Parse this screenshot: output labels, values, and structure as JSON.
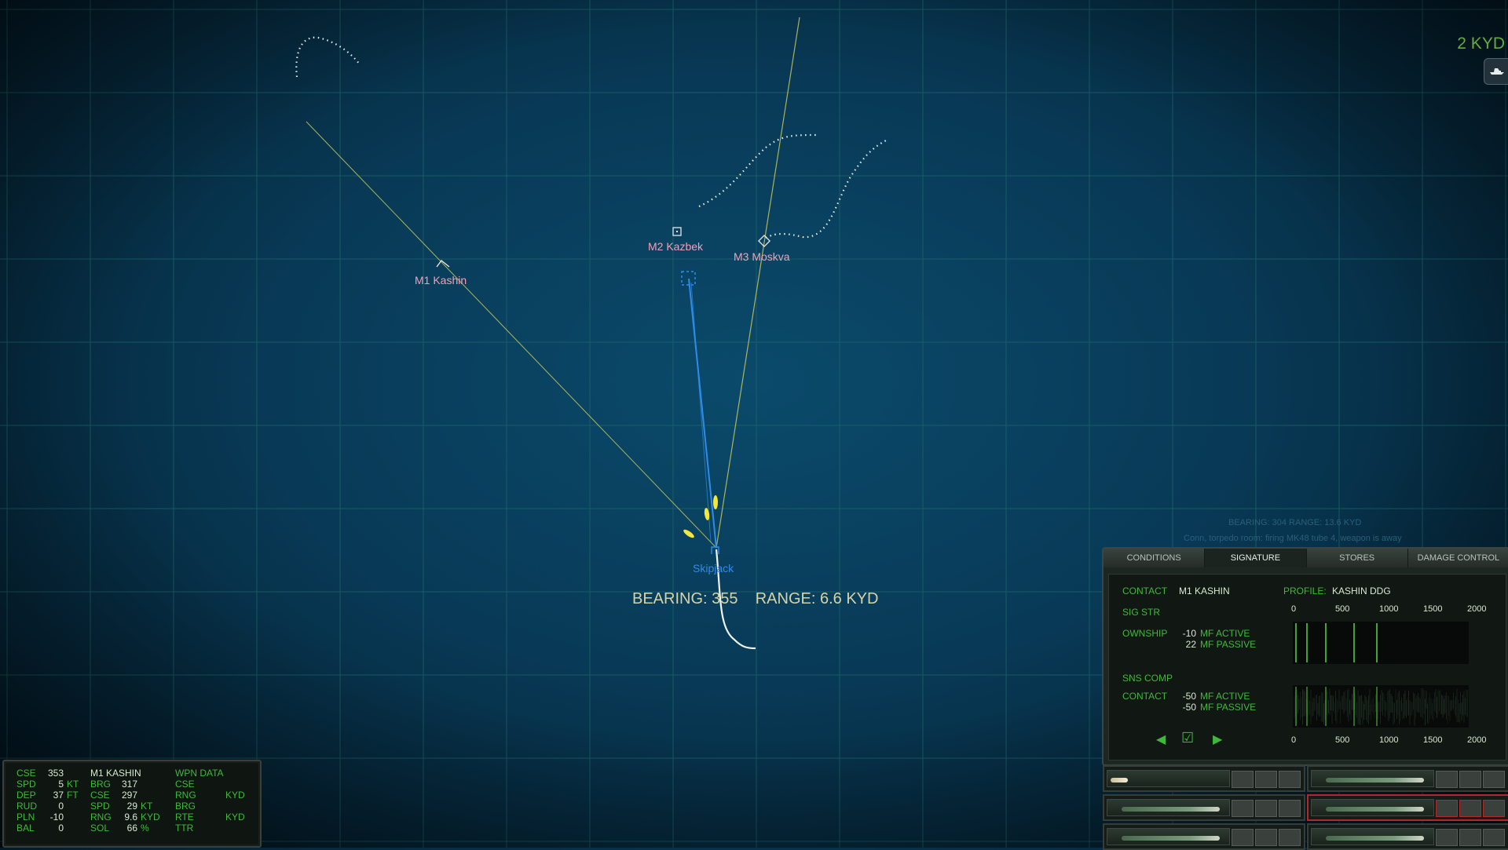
{
  "map": {
    "scale_label": "2 KYD",
    "bearing_readout": "BEARING: 355    RANGE: 6.6 KYD",
    "contacts": [
      {
        "label": "M1 Kashin",
        "symbol": "corner-marker-icon"
      },
      {
        "label": "M2 Kazbek",
        "symbol": "square-marker-icon"
      },
      {
        "label": "M3 Moskva",
        "symbol": "diamond-marker-icon"
      }
    ],
    "ownship": {
      "label": "Skipjack"
    },
    "colors": {
      "contact": "#f0a0b8",
      "ownship": "#2f8be8",
      "bearing_line": "#c8c95a",
      "torpedo": "#f5e83a"
    }
  },
  "status": {
    "line1": "BEARING: 304   RANGE: 13.6 KYD",
    "line2": "Conn, torpedo room: firing MK48 tube 4, weapon is away"
  },
  "tma": {
    "ownship": [
      {
        "k": "CSE",
        "v": "353",
        "u": ""
      },
      {
        "k": "SPD",
        "v": "5",
        "u": "KT"
      },
      {
        "k": "DEP",
        "v": "37",
        "u": "FT"
      },
      {
        "k": "RUD",
        "v": "0",
        "u": ""
      },
      {
        "k": "PLN",
        "v": "-10",
        "u": ""
      },
      {
        "k": "BAL",
        "v": "0",
        "u": ""
      }
    ],
    "target_title": "M1 KASHIN",
    "target": [
      {
        "k": "BRG",
        "v": "317",
        "u": ""
      },
      {
        "k": "CSE",
        "v": "297",
        "u": ""
      },
      {
        "k": "SPD",
        "v": "29",
        "u": "KT"
      },
      {
        "k": "RNG",
        "v": "9.6",
        "u": "KYD"
      },
      {
        "k": "SOL",
        "v": "66",
        "u": "%"
      }
    ],
    "weapon_title": "WPN DATA",
    "weapon": [
      {
        "k": "CSE",
        "u": ""
      },
      {
        "k": "RNG",
        "u": "KYD"
      },
      {
        "k": "BRG",
        "u": ""
      },
      {
        "k": "RTE",
        "u": "KYD"
      },
      {
        "k": "TTR",
        "u": ""
      }
    ]
  },
  "panel": {
    "tabs": [
      "CONDITIONS",
      "SIGNATURE",
      "STORES",
      "DAMAGE CONTROL"
    ],
    "active_tab": 1,
    "contact_label": "CONTACT",
    "contact_value": "M1 KASHIN",
    "profile_label": "PROFILE:",
    "profile_value": "KASHIN DDG",
    "sig_str": "SIG STR",
    "sns_comp": "SNS COMP",
    "ownship_label": "OWNSHIP",
    "ownship_vals": [
      "-10",
      "22"
    ],
    "contact_row_label": "CONTACT",
    "contact_vals": [
      "-50",
      "-50"
    ],
    "mf_active": "MF ACTIVE",
    "mf_passive": "MF PASSIVE",
    "axis_ticks": [
      "0",
      "500",
      "1000",
      "1500",
      "2000"
    ]
  },
  "tubes": [
    {
      "state": "empty-loading"
    },
    {
      "state": "loaded"
    },
    {
      "state": "loaded"
    },
    {
      "state": "loaded-selected"
    },
    {
      "state": "loaded"
    },
    {
      "state": "loaded"
    }
  ]
}
